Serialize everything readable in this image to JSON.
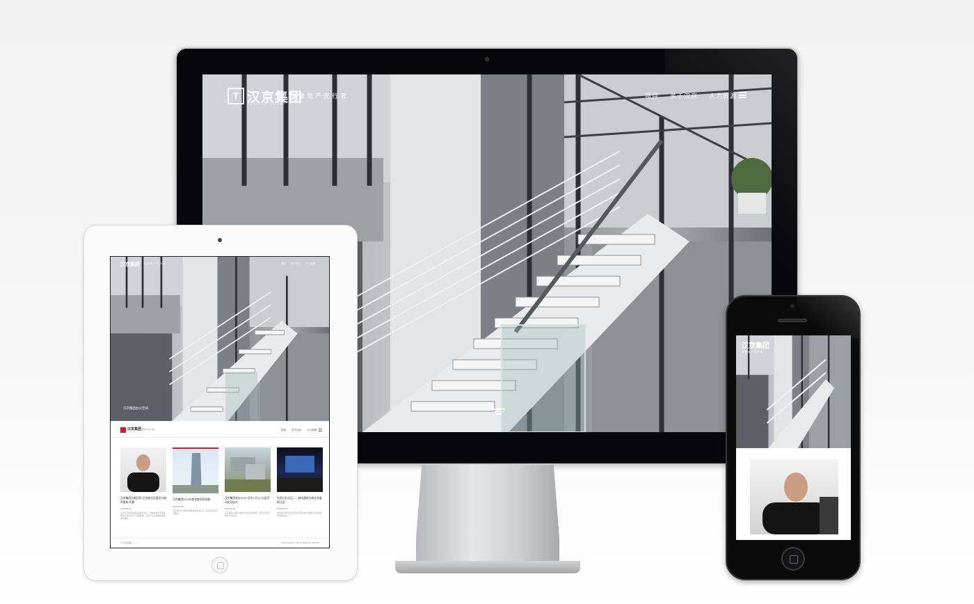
{
  "site": {
    "logo_text": "汉京集团",
    "logo_sub": "HANKING GROUP",
    "tagline": "创意地产先行者",
    "nav": [
      "项目",
      "关于汉京",
      "人力资源"
    ]
  },
  "tablet": {
    "hero_caption": "汉京集团办公空间",
    "cards": [
      {
        "title": "汉京集团总裁回答“汉京商业区建设与城市更新”问题",
        "date": "2015-02-02",
        "text": "近日汉京集团总裁接受媒体专访，对城市更新项目的规划与建设进行了详细阐述，并表示汉京将继续秉承创新理念。"
      },
      {
        "title": "汉京集团2015年各季度项目进展",
        "date": "2015-02-02",
        "text": "汉京集团2015年度项目进展情况汇总，各项目建设有序推进。"
      },
      {
        "title": "汉京集团举办2015“汉京一片心”公益活动启动仪式",
        "date": "2015-02-02",
        "text": "汉京集团公益活动启动仪式在深圳举行，集团高层及各界代表出席。"
      },
      {
        "title": "先进行业论坛——城市建筑与商业发展研讨会",
        "date": "2015-02-02",
        "text": "本次论坛邀请行业专家共同探讨城市建筑与商业发展的未来方向。"
      }
    ],
    "footer_left": "◎ 汉京集团 ○ ○ ○",
    "footer_right": "COPYRIGHT © 2015 HANKING GROUP"
  },
  "icons": {
    "menu": "hamburger-menu-icon",
    "filter": "filter-lines-icon",
    "apple": "apple-logo-icon"
  }
}
